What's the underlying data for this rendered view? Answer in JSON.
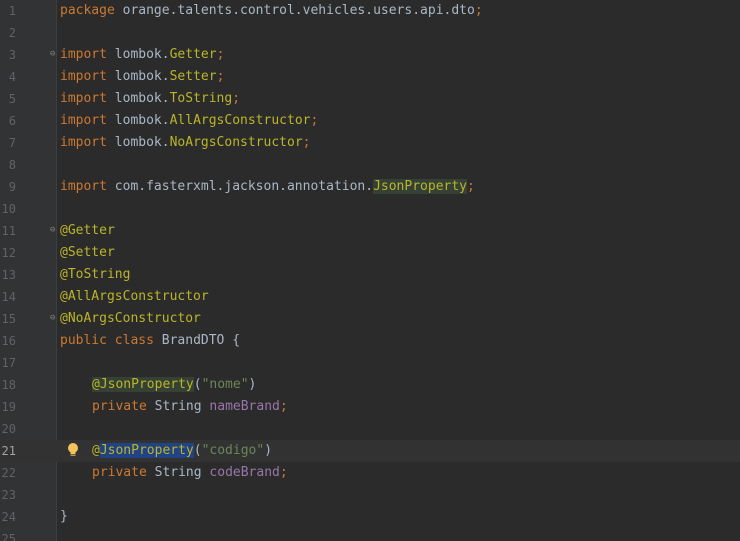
{
  "editor": {
    "line_numbers": [
      "1",
      "2",
      "3",
      "4",
      "5",
      "6",
      "7",
      "8",
      "9",
      "10",
      "11",
      "12",
      "13",
      "14",
      "15",
      "16",
      "17",
      "18",
      "19",
      "20",
      "21",
      "22",
      "23",
      "24",
      "25"
    ],
    "current_line": "21",
    "tokens": {
      "l1_kw": "package",
      "l1_pkg": " orange.talents.control.vehicles.users.api.dto",
      "semi": ";",
      "import_kw": "import",
      "l3_a": " lombok.",
      "l3_b": "Getter",
      "l4_a": " lombok.",
      "l4_b": "Setter",
      "l5_a": " lombok.",
      "l5_b": "ToString",
      "l6_a": " lombok.",
      "l6_b": "AllArgsConstructor",
      "l7_a": " lombok.",
      "l7_b": "NoArgsConstructor",
      "l9_a": " com.fasterxml.jackson.annotation.",
      "l9_b": "JsonProperty",
      "l11": "@Getter",
      "l12": "@Setter",
      "l13": "@ToString",
      "l14": "@AllArgsConstructor",
      "l15": "@NoArgsConstructor",
      "l16_public": "public",
      "l16_class": " class",
      "l16_name": " BrandDTO {",
      "l18_at": "@JsonProperty",
      "l18_open": "(",
      "l18_str": "\"nome\"",
      "l18_close": ")",
      "private_kw": "private",
      "string_type": " String ",
      "l19_field": "nameBrand",
      "l21_at": "@",
      "l21_name": "JsonProperty",
      "l21_open": "(",
      "l21_str": "\"codigo\"",
      "l21_close": ")",
      "l22_field": "codeBrand",
      "l24": "}"
    },
    "fold_marker": "⊖",
    "intention_icon": "lightbulb-icon",
    "colors": {
      "background": "#2b2b2b",
      "keyword": "#cc7832",
      "annotation": "#bbb529",
      "string": "#6a8759",
      "field": "#9876aa",
      "text": "#a9b7c6"
    }
  }
}
